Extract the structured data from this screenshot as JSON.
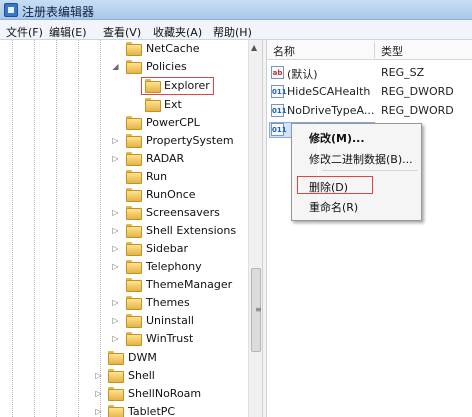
{
  "window": {
    "title": "注册表编辑器",
    "icon": "registry-editor-icon"
  },
  "menubar": [
    "文件(F)",
    "编辑(E)",
    "查看(V)",
    "收藏夹(A)",
    "帮助(H)"
  ],
  "tree": {
    "items": [
      {
        "label": "NetCache",
        "expander": ""
      },
      {
        "label": "Policies",
        "expander": "◢"
      },
      {
        "label": "Explorer",
        "expander": "",
        "selected": true
      },
      {
        "label": "Ext",
        "expander": ""
      },
      {
        "label": "PowerCPL",
        "expander": ""
      },
      {
        "label": "PropertySystem",
        "expander": "▷"
      },
      {
        "label": "RADAR",
        "expander": "▷"
      },
      {
        "label": "Run",
        "expander": ""
      },
      {
        "label": "RunOnce",
        "expander": ""
      },
      {
        "label": "Screensavers",
        "expander": "▷"
      },
      {
        "label": "Shell Extensions",
        "expander": "▷"
      },
      {
        "label": "Sidebar",
        "expander": "▷"
      },
      {
        "label": "Telephony",
        "expander": "▷"
      },
      {
        "label": "ThemeManager",
        "expander": ""
      },
      {
        "label": "Themes",
        "expander": "▷"
      },
      {
        "label": "Uninstall",
        "expander": "▷"
      },
      {
        "label": "WinTrust",
        "expander": "▷"
      },
      {
        "label": "DWM",
        "expander": ""
      },
      {
        "label": "Shell",
        "expander": "▷"
      },
      {
        "label": "ShellNoRoam",
        "expander": "▷"
      },
      {
        "label": "TabletPC",
        "expander": "▷"
      }
    ],
    "scrollbar_grip": "≡"
  },
  "list": {
    "columns": {
      "name": "名称",
      "type": "类型"
    },
    "rows": [
      {
        "icon": "ab",
        "name": "(默认)",
        "type": "REG_SZ"
      },
      {
        "icon": "011",
        "name": "HideSCAHealth",
        "type": "REG_DWORD"
      },
      {
        "icon": "011",
        "name": "NoDriveTypeA...",
        "type": "REG_DWORD"
      },
      {
        "icon": "011",
        "name": "",
        "type": "",
        "selected": true
      }
    ]
  },
  "context_menu": {
    "modify": "修改(M)...",
    "modify_binary": "修改二进制数据(B)...",
    "delete": "删除(D)",
    "rename": "重命名(R)"
  },
  "colors": {
    "highlight_box": "#e04545",
    "selection": "#cfe3fb",
    "title_bar": "#a9c7ea"
  }
}
